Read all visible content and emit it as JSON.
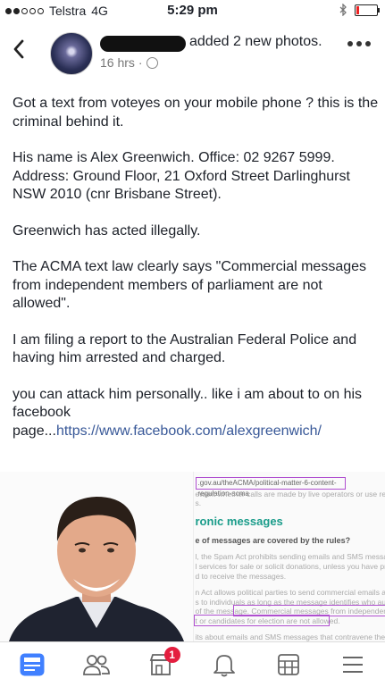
{
  "status_bar": {
    "carrier": "Telstra",
    "network": "4G",
    "time": "5:29 pm"
  },
  "header": {
    "action_text": "added 2 new photos.",
    "timestamp": "16 hrs"
  },
  "post": {
    "p1": "Got a text from voteyes on your mobile phone ? this is the criminal behind it.",
    "p2": "His name is Alex Greenwich. Office: 02 9267 5999. Address: Ground Floor, 21 Oxford Street Darlinghurst NSW 2010 (cnr Brisbane Street).",
    "p3": "Greenwich has acted illegally.",
    "p4": "The ACMA text law clearly says \"Commercial messages from independent members of parliament are not allowed\".",
    "p5": "I am filing a report to the Australian Federal Police and having him arrested and charged.",
    "p6_text": "you can attack him personally.. like i am about to on his facebook page...",
    "p6_link": "https://www.facebook.com/alexgreenwich/"
  },
  "photo_right": {
    "url": ".gov.au/theACMA/political-matter-6-content-regulation-acma",
    "line1": "ewant whether calls are made by live operators or use recorded",
    "line2": "s.",
    "heading": "ronic messages",
    "question": "e of messages are covered by the rules?",
    "l1": "l, the Spam Act prohibits sending emails and SMS messages th",
    "l2": "l services for sale or solicit donations, unless you have previous",
    "l3": "d to receive the messages.",
    "l4": "n Act allows political parties to send commercial emails and SM",
    "l5": "s to individuals as long as the message identifies who authorise",
    "l6": "of the message. Commercial messages from independent memb",
    "l7": "t or candidates for election are not allowed.",
    "l8": "its about emails and SMS messages that contravene the Spam"
  },
  "tabbar": {
    "notifications_badge": "1"
  },
  "colors": {
    "link": "#385898",
    "highlight": "#b04fd0",
    "badge": "#e41e3f",
    "tab_active": "#4080ff"
  }
}
